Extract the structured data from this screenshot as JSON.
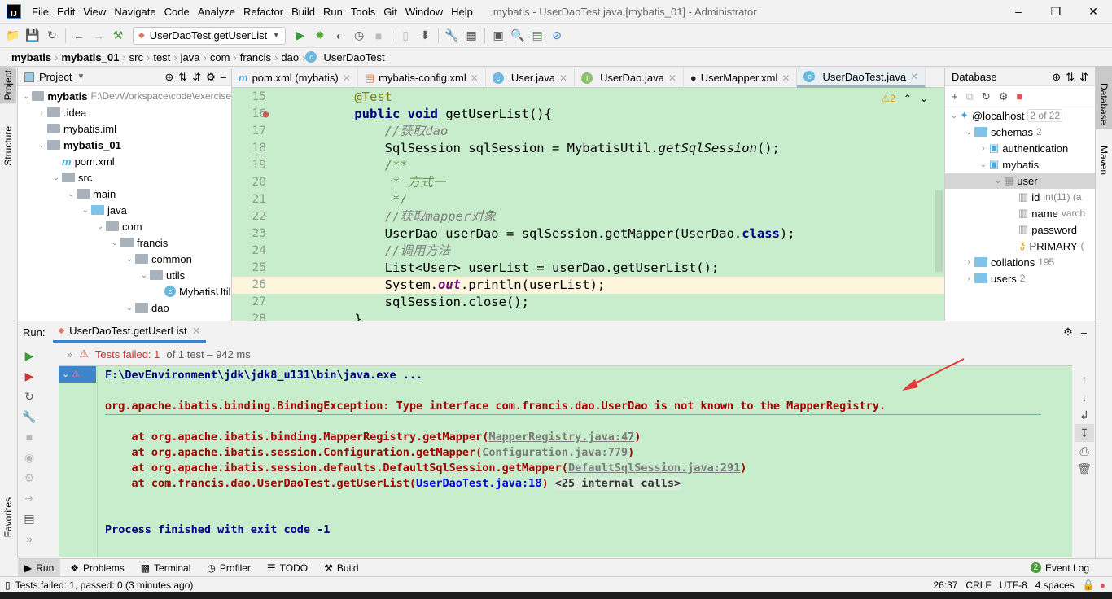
{
  "app": {
    "logo": "IJ",
    "title": "mybatis - UserDaoTest.java [mybatis_01] - Administrator",
    "menu": [
      "File",
      "Edit",
      "View",
      "Navigate",
      "Code",
      "Analyze",
      "Refactor",
      "Build",
      "Run",
      "Tools",
      "Git",
      "Window",
      "Help"
    ]
  },
  "toolbar": {
    "run_config": "UserDaoTest.getUserList"
  },
  "breadcrumb": [
    "mybatis",
    "mybatis_01",
    "src",
    "test",
    "java",
    "com",
    "francis",
    "dao",
    "UserDaoTest"
  ],
  "left_stripe": [
    "Project",
    "Structure",
    "Favorites"
  ],
  "right_stripe": [
    "Database",
    "Maven"
  ],
  "project": {
    "title": "Project",
    "items": [
      {
        "label": "mybatis",
        "extra": "F:\\DevWorkspace\\code\\exercise",
        "depth": 0,
        "bold": true,
        "open": true
      },
      {
        "label": ".idea",
        "depth": 1,
        "closed": true
      },
      {
        "label": "mybatis.iml",
        "depth": 1
      },
      {
        "label": "mybatis_01",
        "depth": 1,
        "bold": true,
        "open": true
      },
      {
        "label": "pom.xml",
        "depth": 2
      },
      {
        "label": "src",
        "depth": 2,
        "open": true
      },
      {
        "label": "main",
        "depth": 3,
        "open": true
      },
      {
        "label": "java",
        "depth": 4,
        "open": true
      },
      {
        "label": "com",
        "depth": 5,
        "open": true
      },
      {
        "label": "francis",
        "depth": 6,
        "open": true
      },
      {
        "label": "common",
        "depth": 7,
        "open": true
      },
      {
        "label": "utils",
        "depth": 8,
        "open": true
      },
      {
        "label": "MybatisUtil",
        "depth": 9
      },
      {
        "label": "dao",
        "depth": 7,
        "open": true
      }
    ]
  },
  "editor": {
    "tabs": [
      {
        "label": "pom.xml (mybatis)",
        "icon": "m"
      },
      {
        "label": "mybatis-config.xml",
        "icon": "xml"
      },
      {
        "label": "User.java",
        "icon": "c"
      },
      {
        "label": "UserDao.java",
        "icon": "i"
      },
      {
        "label": "UserMapper.xml",
        "icon": "mybatis"
      },
      {
        "label": "UserDaoTest.java",
        "icon": "c",
        "active": true
      }
    ],
    "warnings": "2",
    "lines": [
      {
        "n": "15",
        "tokens": [
          [
            "    ",
            "pl"
          ],
          [
            "@Test",
            "an"
          ]
        ]
      },
      {
        "n": "16",
        "tokens": [
          [
            "    ",
            "pl"
          ],
          [
            "public void ",
            "kw"
          ],
          [
            "getUserList(){",
            "pl"
          ]
        ]
      },
      {
        "n": "17",
        "tokens": [
          [
            "        ",
            "pl"
          ],
          [
            "//获取dao",
            "cm"
          ]
        ]
      },
      {
        "n": "18",
        "tokens": [
          [
            "        SqlSession sqlSession = MybatisUtil.",
            "pl"
          ],
          [
            "getSqlSession",
            "st"
          ],
          [
            "();",
            "pl"
          ]
        ]
      },
      {
        "n": "19",
        "tokens": [
          [
            "        ",
            "pl"
          ],
          [
            "/**",
            "doc"
          ]
        ]
      },
      {
        "n": "20",
        "tokens": [
          [
            "         ",
            "pl"
          ],
          [
            "* 方式一",
            "doc"
          ]
        ]
      },
      {
        "n": "21",
        "tokens": [
          [
            "         ",
            "pl"
          ],
          [
            "*/",
            "doc"
          ]
        ]
      },
      {
        "n": "22",
        "tokens": [
          [
            "        ",
            "pl"
          ],
          [
            "//获取mapper对象",
            "cm"
          ]
        ]
      },
      {
        "n": "23",
        "tokens": [
          [
            "        UserDao userDao = sqlSession.getMapper(UserDao.",
            "pl"
          ],
          [
            "class",
            "kw"
          ],
          [
            ");",
            "pl"
          ]
        ]
      },
      {
        "n": "24",
        "tokens": [
          [
            "        ",
            "pl"
          ],
          [
            "//调用方法",
            "cm"
          ]
        ]
      },
      {
        "n": "25",
        "tokens": [
          [
            "        List<User> userList = userDao.getUserList();",
            "pl"
          ]
        ]
      },
      {
        "n": "26",
        "tokens": [
          [
            "        System.",
            "pl"
          ],
          [
            "out",
            "fld"
          ],
          [
            ".println(userList);",
            "pl"
          ]
        ],
        "current": true
      },
      {
        "n": "27",
        "tokens": [
          [
            "        sqlSession.close();",
            "pl"
          ]
        ]
      },
      {
        "n": "28",
        "tokens": [
          [
            "    }",
            "pl"
          ]
        ]
      }
    ]
  },
  "database": {
    "title": "Database",
    "items": [
      {
        "label": "@localhost",
        "badge": "2 of 22",
        "depth": 0,
        "open": true
      },
      {
        "label": "schemas",
        "count": "2",
        "depth": 1,
        "open": true
      },
      {
        "label": "authentication",
        "depth": 2,
        "closed": true
      },
      {
        "label": "mybatis",
        "depth": 2,
        "open": true
      },
      {
        "label": "user",
        "depth": 3,
        "open": true,
        "selected": true
      },
      {
        "label": "id",
        "type": "int(11) (a",
        "depth": 4
      },
      {
        "label": "name",
        "type": "varch",
        "depth": 4
      },
      {
        "label": "password",
        "depth": 4
      },
      {
        "label": "PRIMARY",
        "type": "(",
        "depth": 4
      },
      {
        "label": "collations",
        "count": "195",
        "depth": 1,
        "closed": true
      },
      {
        "label": "users",
        "count": "2",
        "depth": 1,
        "closed": true
      }
    ]
  },
  "run": {
    "label": "Run:",
    "tab": "UserDaoTest.getUserList",
    "status_prefix": "Tests failed:",
    "failed": "1",
    "status_rest": "of 1 test – 942 ms",
    "console": {
      "cmd": "F:\\DevEnvironment\\jdk\\jdk8_u131\\bin\\java.exe ...",
      "exception": "org.apache.ibatis.binding.BindingException: Type interface com.francis.dao.UserDao is not known to the MapperRegistry.",
      "stack": [
        {
          "at": "    at org.apache.ibatis.binding.MapperRegistry.getMapper(",
          "link": "MapperRegistry.java:47",
          "end": ")"
        },
        {
          "at": "    at org.apache.ibatis.session.Configuration.getMapper(",
          "link": "Configuration.java:779",
          "end": ")"
        },
        {
          "at": "    at org.apache.ibatis.session.defaults.DefaultSqlSession.getMapper(",
          "link": "DefaultSqlSession.java:291",
          "end": ")"
        },
        {
          "at": "    at com.francis.dao.UserDaoTest.getUserList(",
          "link": "UserDaoTest.java:18",
          "end": ") ",
          "internal": "<25 internal calls>"
        }
      ],
      "exit": "Process finished with exit code -1"
    }
  },
  "bottom_tabs": [
    "Run",
    "Problems",
    "Terminal",
    "Profiler",
    "TODO",
    "Build"
  ],
  "event_log": {
    "count": "2",
    "label": "Event Log"
  },
  "status": {
    "message": "Tests failed: 1, passed: 0 (3 minutes ago)",
    "position": "26:37",
    "line_sep": "CRLF",
    "encoding": "UTF-8",
    "indent": "4 spaces"
  },
  "colors": {
    "editor_bg": "#c7edcc",
    "error": "#a00000",
    "accent": "#4083c9",
    "annotation_arrow": "#e53935"
  }
}
